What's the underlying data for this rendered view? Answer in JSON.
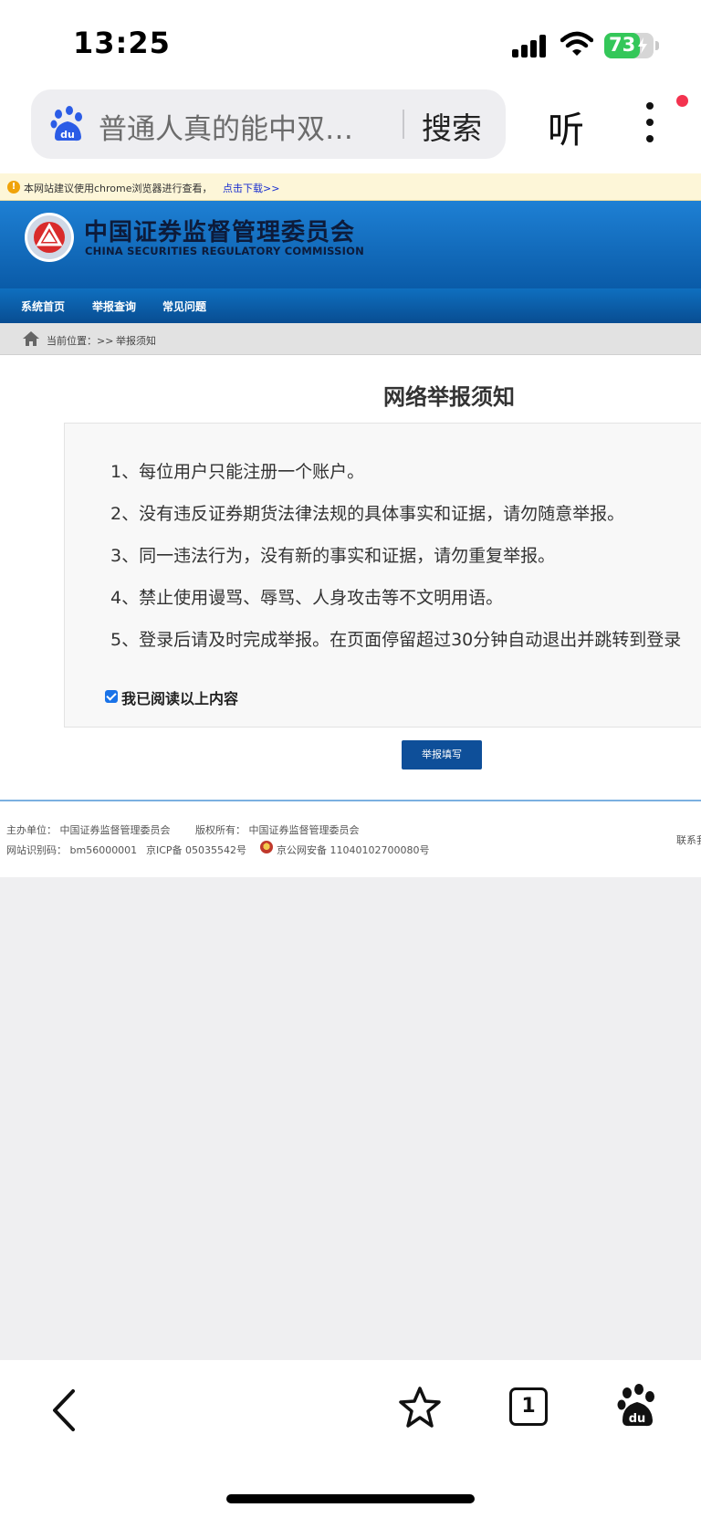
{
  "status_bar": {
    "time": "13:25",
    "battery": "73",
    "battery_level_percent": 73,
    "icons": [
      "cellular-signal-icon",
      "wifi-icon",
      "battery-charging-icon"
    ]
  },
  "browser": {
    "search_query": "普通人真的能中双…",
    "search_button": "搜索",
    "listen_button": "听",
    "icons": [
      "baidu-paw-icon",
      "more-vertical-icon"
    ],
    "accent_color": "#f3334f"
  },
  "notice": {
    "text": "本网站建议使用chrome浏览器进行查看，",
    "link": "点击下载>>"
  },
  "header": {
    "name_cn": "中国证券监督管理委员会",
    "name_en": "CHINA SECURITIES REGULATORY COMMISSION",
    "brand_color": "#0a5ba8"
  },
  "nav": {
    "items": [
      {
        "label": "系统首页"
      },
      {
        "label": "举报查询"
      },
      {
        "label": "常见问题"
      }
    ]
  },
  "breadcrumb": {
    "prefix": "当前位置：>>",
    "current": "举报须知"
  },
  "content": {
    "title": "网络举报须知",
    "rules": [
      "1、每位用户只能注册一个账户。",
      "2、没有违反证券期货法律法规的具体事实和证据，请勿随意举报。",
      "3、同一违法行为，没有新的事实和证据，请勿重复举报。",
      "4、禁止使用谩骂、辱骂、人身攻击等不文明用语。",
      "5、登录后请及时完成举报。在页面停留超过30分钟自动退出并跳转到登录"
    ],
    "agree_label": "我已阅读以上内容",
    "agree_checked": true,
    "submit_button": "举报填写"
  },
  "footer": {
    "host": "主办单位：  中国证券监督管理委员会",
    "copyright": "版权所有：  中国证券监督管理委员会",
    "site_id": "网站识别码：  bm56000001",
    "icp": "京ICP备 05035542号",
    "police": "京公网安备 11040102700080号",
    "contact": "联系我"
  },
  "bottom_bar": {
    "tab_count": "1",
    "icons": [
      "back-arrow-icon",
      "star-icon",
      "tabs-icon",
      "baidu-paw-icon"
    ]
  }
}
